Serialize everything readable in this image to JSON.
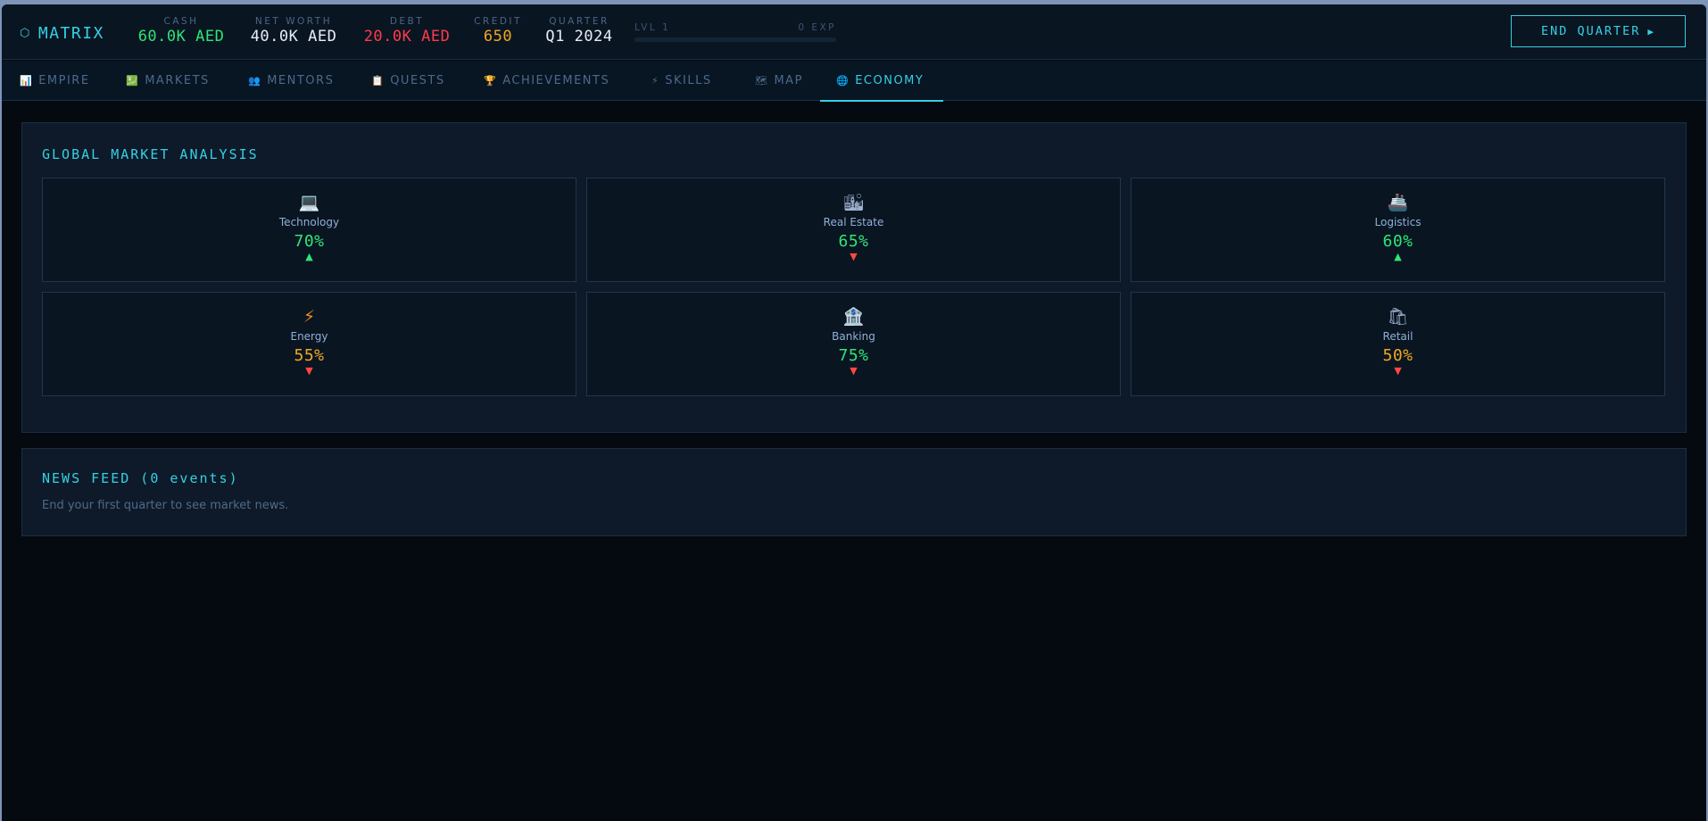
{
  "header": {
    "logo": "MATRIX",
    "stats": {
      "cash": {
        "label": "CASH",
        "value": "60.0K AED",
        "color": "#2ee676"
      },
      "net_worth": {
        "label": "NET WORTH",
        "value": "40.0K AED",
        "color": "#e8eef6"
      },
      "debt": {
        "label": "DEBT",
        "value": "20.0K AED",
        "color": "#ff3b4a"
      },
      "credit": {
        "label": "CREDIT",
        "value": "650",
        "color": "#f0a820"
      },
      "quarter": {
        "label": "QUARTER",
        "value": "Q1 2024",
        "color": "#e8eef6"
      }
    },
    "level": {
      "label": "LVL 1",
      "exp": "0 EXP",
      "progress": 0
    },
    "end_quarter": "END QUARTER"
  },
  "tabs": [
    {
      "id": "empire",
      "label": "EMPIRE",
      "icon": "📊"
    },
    {
      "id": "markets",
      "label": "MARKETS",
      "icon": "💹"
    },
    {
      "id": "mentors",
      "label": "MENTORS",
      "icon": "👥"
    },
    {
      "id": "quests",
      "label": "QUESTS",
      "icon": "📋"
    },
    {
      "id": "achievements",
      "label": "ACHIEVEMENTS",
      "icon": "🏆"
    },
    {
      "id": "skills",
      "label": "SKILLS",
      "icon": "⚡"
    },
    {
      "id": "map",
      "label": "MAP",
      "icon": "🗺"
    },
    {
      "id": "economy",
      "label": "ECONOMY",
      "icon": "🌐"
    }
  ],
  "active_tab": "economy",
  "market": {
    "title": "GLOBAL MARKET ANALYSIS",
    "sectors": [
      {
        "name": "Technology",
        "icon": "💻",
        "value": "70%",
        "trend": "up"
      },
      {
        "name": "Real Estate",
        "icon": "🏙",
        "value": "65%",
        "trend": "down"
      },
      {
        "name": "Logistics",
        "icon": "🚢",
        "value": "60%",
        "trend": "up"
      },
      {
        "name": "Energy",
        "icon": "⚡",
        "value": "55%",
        "trend": "down"
      },
      {
        "name": "Banking",
        "icon": "🏦",
        "value": "75%",
        "trend": "down"
      },
      {
        "name": "Retail",
        "icon": "🛍",
        "value": "50%",
        "trend": "down"
      }
    ]
  },
  "news": {
    "title": "NEWS FEED (0 events)",
    "empty_text": "End your first quarter to see market news."
  },
  "colors": {
    "accent": "#35d0e3",
    "up": "#2ee676",
    "down": "#ff4a3d",
    "value_high": "#2ee676",
    "value_mid": "#f0a820"
  }
}
